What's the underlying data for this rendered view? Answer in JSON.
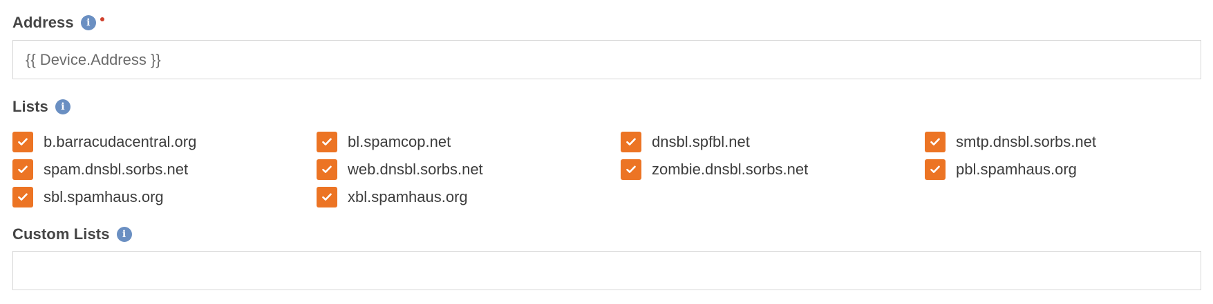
{
  "address": {
    "label": "Address",
    "info_icon": "info-icon",
    "required": true,
    "value": "{{ Device.Address }}",
    "colors": {
      "required_dot": "#d0402c",
      "info": "#6a8fc2"
    }
  },
  "lists": {
    "label": "Lists",
    "info_icon": "info-icon",
    "checkbox_color": "#ec7424",
    "items": [
      {
        "label": "b.barracudacentral.org",
        "checked": true
      },
      {
        "label": "bl.spamcop.net",
        "checked": true
      },
      {
        "label": "dnsbl.spfbl.net",
        "checked": true
      },
      {
        "label": "smtp.dnsbl.sorbs.net",
        "checked": true
      },
      {
        "label": "spam.dnsbl.sorbs.net",
        "checked": true
      },
      {
        "label": "web.dnsbl.sorbs.net",
        "checked": true
      },
      {
        "label": "zombie.dnsbl.sorbs.net",
        "checked": true
      },
      {
        "label": "pbl.spamhaus.org",
        "checked": true
      },
      {
        "label": "sbl.spamhaus.org",
        "checked": true
      },
      {
        "label": "xbl.spamhaus.org",
        "checked": true
      }
    ]
  },
  "custom_lists": {
    "label": "Custom Lists",
    "info_icon": "info-icon",
    "value": ""
  }
}
